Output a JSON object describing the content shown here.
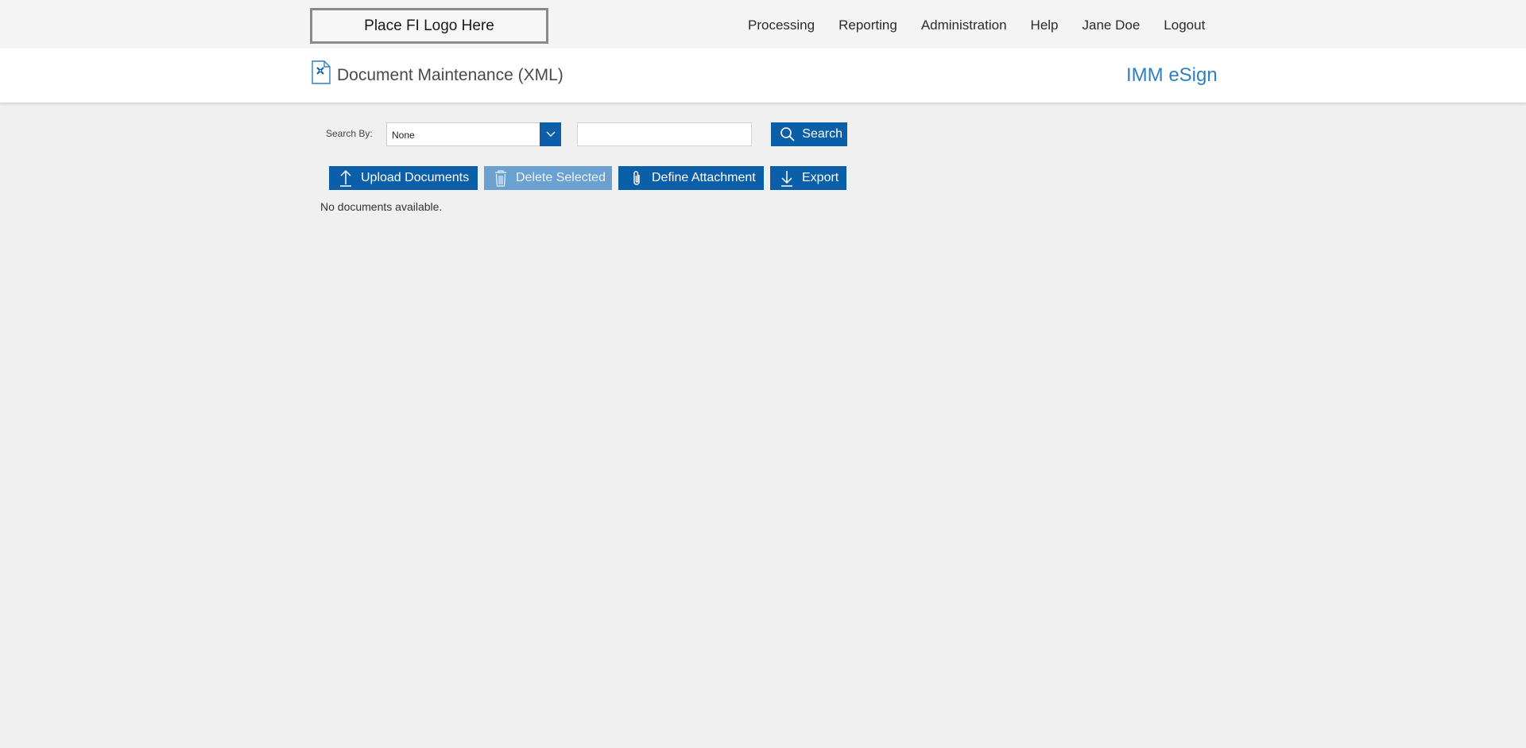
{
  "header": {
    "logo_text": "Place FI Logo Here",
    "nav": [
      {
        "label": "Processing"
      },
      {
        "label": "Reporting"
      },
      {
        "label": "Administration"
      },
      {
        "label": "Help"
      },
      {
        "label": "Jane Doe"
      },
      {
        "label": "Logout"
      }
    ]
  },
  "page": {
    "title": "Document Maintenance (XML)",
    "brand": "IMM eSign",
    "icon": "document-settings-icon"
  },
  "search": {
    "label": "Search By:",
    "selected": "None",
    "input_value": "",
    "button_label": "Search"
  },
  "actions": {
    "upload_label": "Upload Documents",
    "delete_label": "Delete Selected",
    "attach_label": "Define Attachment",
    "export_label": "Export"
  },
  "results": {
    "empty_message": "No documents available."
  },
  "colors": {
    "primary": "#0b5fa8",
    "disabled": "#6ba1d0",
    "brand": "#2f7fc1",
    "background": "#f0f0f0"
  }
}
